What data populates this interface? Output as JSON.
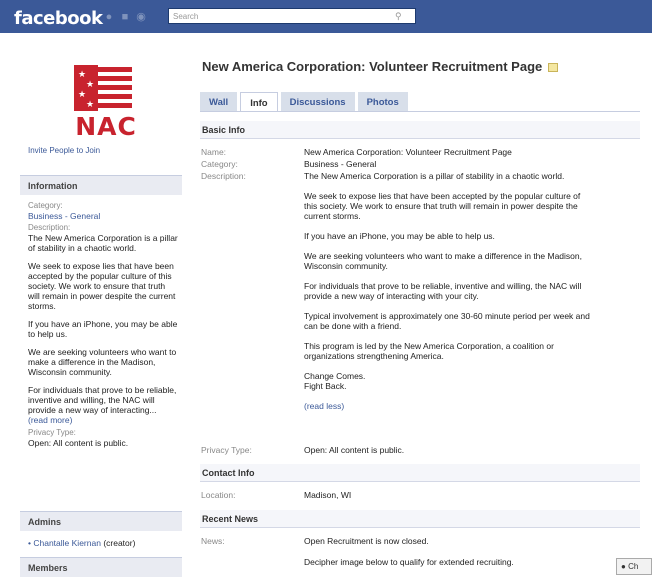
{
  "header": {
    "logo": "facebook",
    "search_placeholder": "Search"
  },
  "sidebar": {
    "logo_text": "NAC",
    "invite_link": "Invite People to Join",
    "information_title": "Information",
    "category_label": "Category:",
    "category_value": "Business - General",
    "description_label": "Description:",
    "description": [
      "The New America Corporation is a pillar of stability in a chaotic world.",
      "We seek to expose lies that have been accepted by the popular culture of this society. We work to ensure that truth will remain in power despite the current storms.",
      "If you have an iPhone, you may be able to help us.",
      "We are seeking volunteers who want to make a difference in the Madison, Wisconsin community.",
      "For individuals that prove to be reliable, inventive and willing, the NAC will provide a new way of interacting..."
    ],
    "read_more": "(read more)",
    "privacy_label": "Privacy Type:",
    "privacy_value": "Open: All content is public.",
    "admins_title": "Admins",
    "admin_name": "Chantalle Kiernan",
    "admin_role": "(creator)",
    "members_title": "Members"
  },
  "page": {
    "title": "New America Corporation: Volunteer Recruitment Page",
    "tabs": [
      "Wall",
      "Info",
      "Discussions",
      "Photos"
    ],
    "active_tab": "Info"
  },
  "basic_info": {
    "heading": "Basic Info",
    "name_label": "Name:",
    "name_value": "New America Corporation: Volunteer Recruitment Page",
    "category_label": "Category:",
    "category_value": "Business - General",
    "description_label": "Description:",
    "description": [
      "The New America Corporation is a pillar of stability in a chaotic world.",
      "We seek to expose lies that have been accepted by the popular culture of this society. We work to ensure that truth will remain in power despite the current storms.",
      "If you have an iPhone, you may be able to help us.",
      "We are seeking volunteers who want to make a difference in the Madison, Wisconsin community.",
      "For individuals that prove to be reliable, inventive and willing, the NAC will provide a new way of interacting with your city.",
      "Typical involvement is approximately one 30-60 minute period per week and can be done with a friend.",
      "This program is led by the New America Corporation, a coalition or organizations strengthening America.",
      "Change Comes.\nFight Back."
    ],
    "read_less": "(read less)",
    "privacy_label": "Privacy Type:",
    "privacy_value": "Open: All content is public."
  },
  "contact_info": {
    "heading": "Contact Info",
    "location_label": "Location:",
    "location_value": "Madison, WI"
  },
  "recent_news": {
    "heading": "Recent News",
    "news_label": "News:",
    "news_lines": [
      "Open Recruitment is now closed.",
      "Decipher image below to qualify for extended recruiting."
    ]
  },
  "chat": {
    "label": "Ch"
  },
  "colors": {
    "brand": "#3b5998",
    "nac_red": "#c8232e"
  }
}
